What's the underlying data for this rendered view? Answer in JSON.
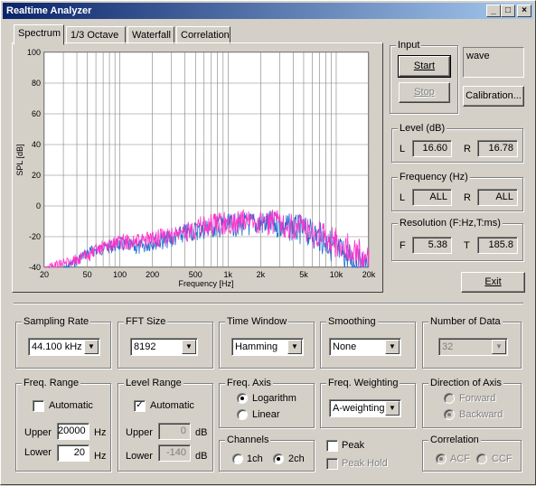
{
  "window": {
    "title": "Realtime Analyzer",
    "min": "_",
    "max": "□",
    "close": "×"
  },
  "tabs": [
    "Spectrum",
    "1/3 Octave",
    "Waterfall",
    "Correlation"
  ],
  "chart_data": {
    "type": "line",
    "xlabel": "Frequency [Hz]",
    "ylabel": "SPL [dB]",
    "xscale": "log",
    "xlim": [
      20,
      20000
    ],
    "ylim": [
      -40,
      100
    ],
    "x_ticks": [
      "20",
      "50",
      "100",
      "200",
      "500",
      "1k",
      "2k",
      "5k",
      "10k",
      "20k"
    ],
    "x_tick_values": [
      20,
      50,
      100,
      200,
      500,
      1000,
      2000,
      5000,
      10000,
      20000
    ],
    "y_ticks": [
      "100",
      "80",
      "60",
      "40",
      "20",
      "0",
      "-20",
      "-40"
    ],
    "y_tick_values": [
      100,
      80,
      60,
      40,
      20,
      0,
      -20,
      -40
    ],
    "grid": true,
    "series": [
      {
        "color": "#1f6fd0",
        "x": [
          30,
          50,
          70,
          100,
          150,
          200,
          300,
          400,
          500,
          700,
          1000,
          1500,
          2000,
          3000,
          5000,
          7000,
          10000,
          15000,
          20000
        ],
        "values": [
          -40,
          -28,
          -25,
          -22,
          -24,
          -20,
          -18,
          -14,
          -12,
          -10,
          -8,
          -7,
          -6,
          -7,
          -10,
          -14,
          -22,
          -30,
          -36
        ]
      },
      {
        "color": "#ff33cc",
        "x": [
          20,
          30,
          50,
          70,
          100,
          150,
          200,
          300,
          400,
          500,
          700,
          1000,
          1500,
          2000,
          3000,
          5000,
          7000,
          10000,
          15000,
          20000
        ],
        "values": [
          -38,
          -35,
          -30,
          -24,
          -20,
          -20,
          -18,
          -16,
          -13,
          -10,
          -8,
          -6,
          -5,
          -5,
          -6,
          -9,
          -13,
          -18,
          -24,
          -28
        ]
      }
    ]
  },
  "input": {
    "label": "Input",
    "start": "Start",
    "stop": "Stop",
    "source": "wave",
    "calibration": "Calibration..."
  },
  "level": {
    "label": "Level (dB)",
    "l_label": "L",
    "r_label": "R",
    "l_value": "16.60",
    "r_value": "16.78"
  },
  "frequency": {
    "label": "Frequency (Hz)",
    "l_label": "L",
    "r_label": "R",
    "l_value": "ALL",
    "r_value": "ALL"
  },
  "resolution": {
    "label": "Resolution (F:Hz,T:ms)",
    "f_label": "F",
    "t_label": "T",
    "f_value": "5.38",
    "t_value": "185.8"
  },
  "exit": "Exit",
  "sampling_rate": {
    "label": "Sampling Rate",
    "value": "44.100 kHz"
  },
  "fft_size": {
    "label": "FFT Size",
    "value": "8192"
  },
  "time_window": {
    "label": "Time Window",
    "value": "Hamming"
  },
  "smoothing": {
    "label": "Smoothing",
    "value": "None"
  },
  "number_of_data": {
    "label": "Number of Data",
    "value": "32"
  },
  "freq_range": {
    "label": "Freq. Range",
    "automatic": "Automatic",
    "upper_label": "Upper",
    "upper_value": "20000",
    "lower_label": "Lower",
    "lower_value": "20",
    "unit": "Hz"
  },
  "level_range": {
    "label": "Level Range",
    "automatic": "Automatic",
    "upper_label": "Upper",
    "upper_value": "0",
    "lower_label": "Lower",
    "lower_value": "-140",
    "unit": "dB"
  },
  "freq_axis": {
    "label": "Freq. Axis",
    "logarithm": "Logarithm",
    "linear": "Linear"
  },
  "freq_weighting": {
    "label": "Freq. Weighting",
    "value": "A-weighting"
  },
  "direction": {
    "label": "Direction of Axis",
    "forward": "Forward",
    "backward": "Backward"
  },
  "channels": {
    "label": "Channels",
    "ch1": "1ch",
    "ch2": "2ch"
  },
  "peak": {
    "peak": "Peak",
    "peak_hold": "Peak Hold"
  },
  "correlation": {
    "label": "Correlation",
    "acf": "ACF",
    "ccf": "CCF"
  }
}
